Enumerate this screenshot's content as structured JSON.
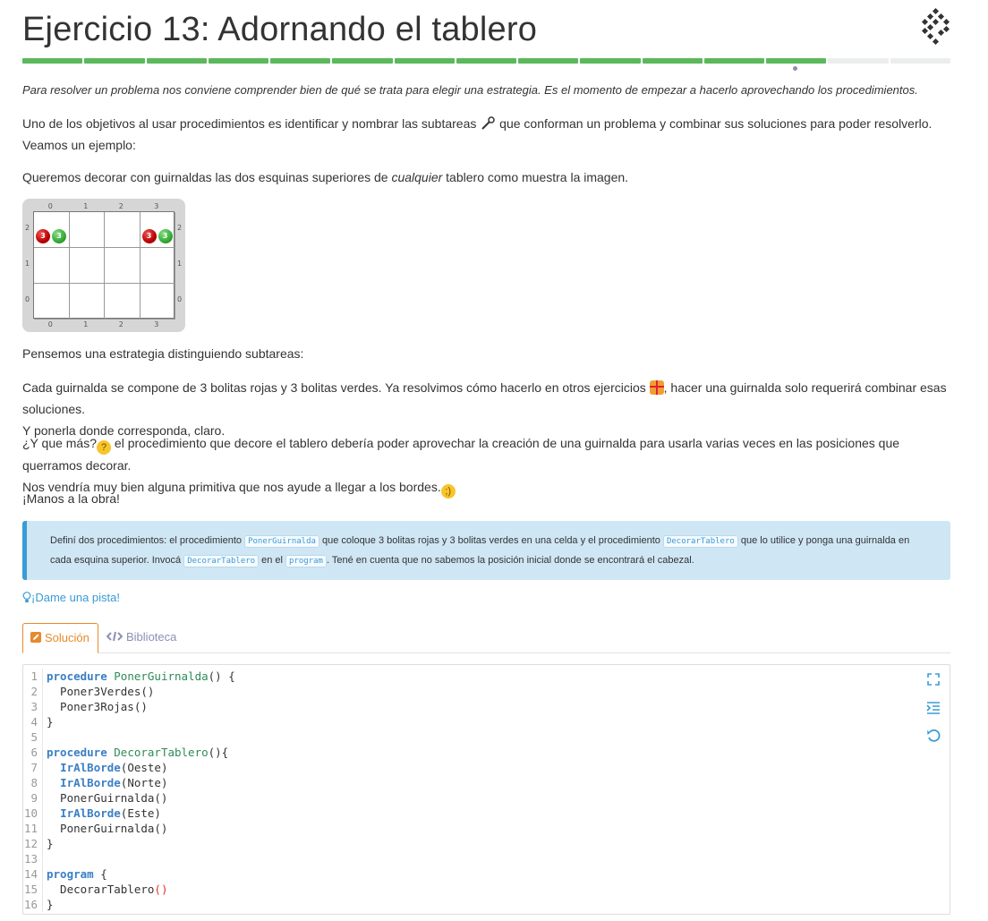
{
  "title": "Ejercicio 13: Adornando el tablero",
  "progress": {
    "total_segments": 15,
    "done_segments": 13
  },
  "intro": "Para resolver un problema nos conviene comprender bien de qué se trata para elegir una estrategia. Es el momento de empezar a hacerlo aprovechando los procedimientos.",
  "p1_a": "Uno de los objetivos al usar procedimientos es identificar y nombrar las subtareas ",
  "p1_b": " que conforman un problema y combinar sus soluciones para poder resolverlo. Veamos un ejemplo:",
  "p2_a": "Queremos decorar con guirnaldas las dos esquinas superiores de ",
  "p2_em": "cualquier",
  "p2_b": " tablero como muestra la imagen.",
  "board": {
    "columns": [
      "0",
      "1",
      "2",
      "3"
    ],
    "rows": [
      "2",
      "1",
      "0"
    ],
    "balls": [
      {
        "col": 0,
        "row": 2,
        "color": "red",
        "count": "3"
      },
      {
        "col": 0,
        "row": 2,
        "color": "green",
        "count": "3"
      },
      {
        "col": 3,
        "row": 2,
        "color": "red",
        "count": "3"
      },
      {
        "col": 3,
        "row": 2,
        "color": "green",
        "count": "3"
      }
    ]
  },
  "p3": "Pensemos una estrategia distinguiendo subtareas:",
  "p4_a": "Cada guirnalda se compone de 3 bolitas rojas y 3 bolitas verdes. Ya resolvimos cómo hacerlo en otros ejercicios ",
  "p4_b": ", hacer una guirnalda solo requerirá combinar esas soluciones.",
  "p4_c": "Y ponerla donde corresponda, claro.",
  "p5_a": "¿Y que más?",
  "p5_b": " el procedimiento que decore el tablero debería poder aprovechar la creación de una guirnalda para usarla varias veces en las posiciones que querramos decorar.",
  "p5_c": "Nos vendría muy bien alguna primitiva que nos ayude a llegar a los bordes.",
  "p6": "¡Manos a la obra!",
  "info": {
    "a": "Definí dos procedimientos: el procedimiento ",
    "code1": "PonerGuirnalda",
    "b": " que coloque 3 bolitas rojas y 3 bolitas verdes en una celda y el procedimiento ",
    "code2": "DecorarTablero",
    "c": " que lo utilice y ponga una guirnalda en cada esquina superior. Invocá ",
    "code3": "DecorarTablero",
    "d": " en el ",
    "code4": "program",
    "e": ". Tené en cuenta que no sabemos la posición inicial donde se encontrará el cabezal."
  },
  "hint": "¡Dame una pista!",
  "tabs": {
    "solution": "Solución",
    "library": "Biblioteca"
  },
  "colors": {
    "progress_done": "#5cb85c",
    "accent": "#3a9bd6",
    "tab_active": "#e8892c"
  },
  "code_lines": [
    [
      {
        "t": "procedure",
        "c": "kw"
      },
      {
        "t": " "
      },
      {
        "t": "PonerGuirnalda",
        "c": "fn"
      },
      {
        "t": "() {"
      }
    ],
    [
      {
        "t": "  Poner3Verdes()"
      }
    ],
    [
      {
        "t": "  Poner3Rojas()"
      }
    ],
    [
      {
        "t": "}"
      }
    ],
    [
      {
        "t": ""
      }
    ],
    [
      {
        "t": "procedure",
        "c": "kw"
      },
      {
        "t": " "
      },
      {
        "t": "DecorarTablero",
        "c": "fn"
      },
      {
        "t": "(){"
      }
    ],
    [
      {
        "t": "  "
      },
      {
        "t": "IrAlBorde",
        "c": "prim"
      },
      {
        "t": "(Oeste)"
      }
    ],
    [
      {
        "t": "  "
      },
      {
        "t": "IrAlBorde",
        "c": "prim"
      },
      {
        "t": "(Norte)"
      }
    ],
    [
      {
        "t": "  PonerGuirnalda()"
      }
    ],
    [
      {
        "t": "  "
      },
      {
        "t": "IrAlBorde",
        "c": "prim"
      },
      {
        "t": "(Este)"
      }
    ],
    [
      {
        "t": "  PonerGuirnalda()"
      }
    ],
    [
      {
        "t": "}"
      }
    ],
    [
      {
        "t": ""
      }
    ],
    [
      {
        "t": "program",
        "c": "kw"
      },
      {
        "t": " {"
      }
    ],
    [
      {
        "t": "  DecorarTablero"
      },
      {
        "t": "()",
        "c": "par"
      }
    ],
    [
      {
        "t": "}"
      }
    ]
  ],
  "editor_tools": [
    "fullscreen-icon",
    "indent-icon",
    "reset-icon"
  ]
}
